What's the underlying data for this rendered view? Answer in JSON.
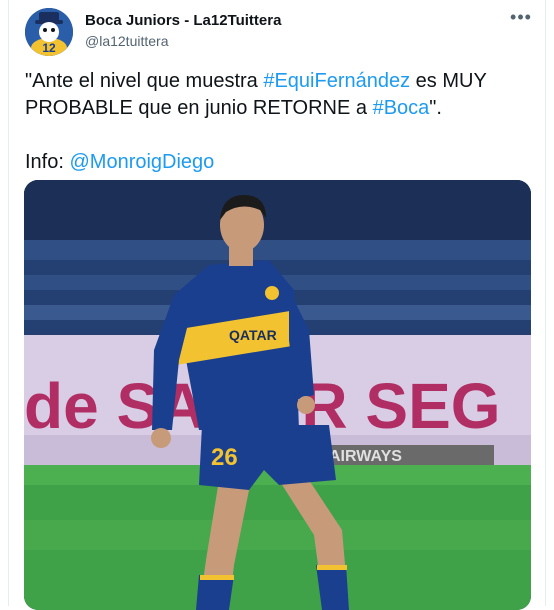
{
  "tweet": {
    "author_name": "Boca Juniors - La12Tuittera",
    "author_handle": "@la12tuittera",
    "more_icon": "more-horizontal-icon",
    "avatar_badge": "12",
    "text_parts": {
      "p1": "\"Ante el nivel que muestra ",
      "hashtag1": "#EquiFernández",
      "p2": " es MUY PROBABLE que en junio RETORNE a ",
      "hashtag2": "#Boca",
      "p3": "\".",
      "info_label": "Info: ",
      "mention": "@MonroigDiego"
    },
    "photo": {
      "jersey_number": "26",
      "sponsor": "QATAR",
      "board_text": "de SABOR SEG",
      "board_text2": "AIRWAYS"
    }
  },
  "colors": {
    "link": "#1d9bf0",
    "text": "#0f1419",
    "secondary": "#536471",
    "boca_blue": "#1b3f8f",
    "boca_gold": "#f2c230"
  }
}
